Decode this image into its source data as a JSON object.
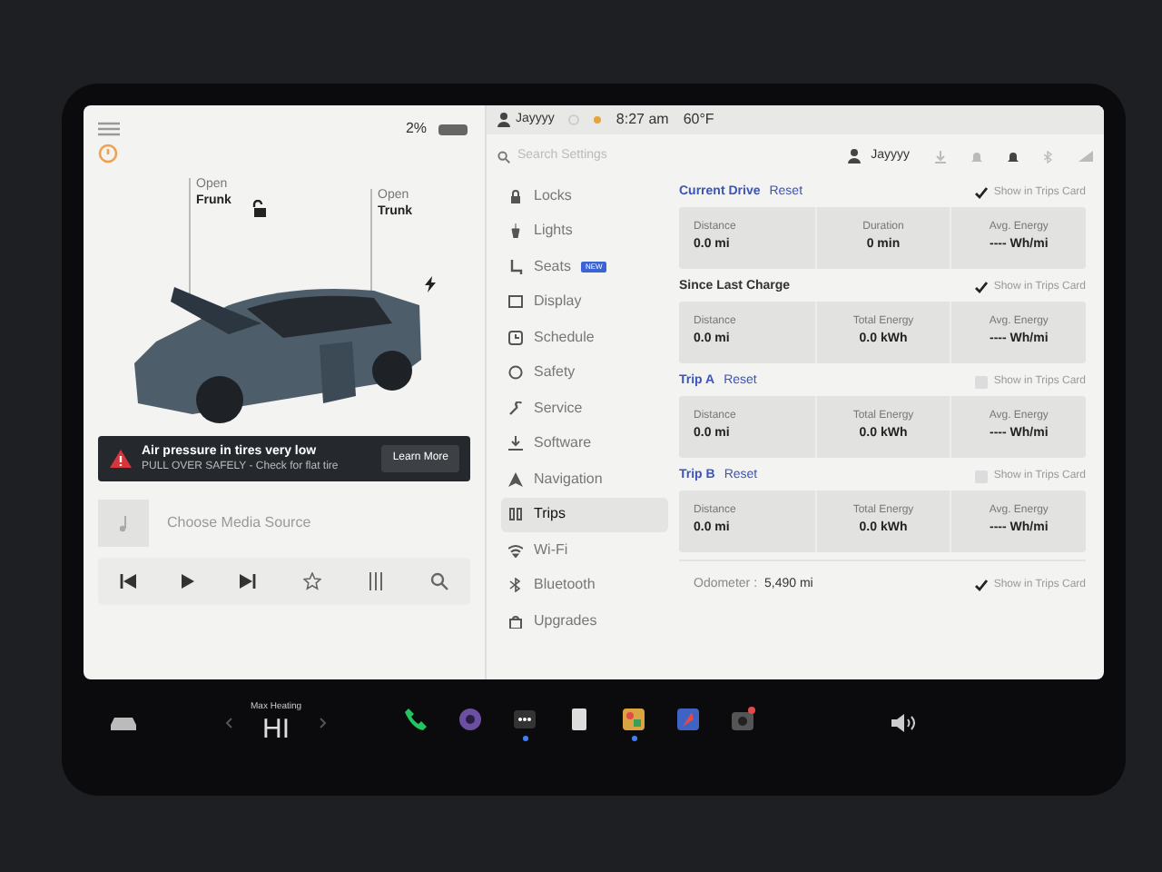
{
  "status_bar": {
    "battery": "2%",
    "user": "Jayyyy",
    "time": "8:27 am",
    "temperature": "60°F"
  },
  "car": {
    "labels": [
      {
        "line1": "Open",
        "line2": "Frunk"
      },
      {
        "line1": "Open",
        "line2": "Trunk"
      }
    ]
  },
  "alert": {
    "title": "Air pressure in tires very low",
    "message": "PULL OVER SAFELY - Check for flat tire",
    "button": "Learn More"
  },
  "media": {
    "source": "Choose Media Source"
  },
  "settings": {
    "search_placeholder": "Search Settings",
    "profile": "Jayyyy",
    "menu": [
      {
        "label": "Locks",
        "kind": "lock",
        "selected": false
      },
      {
        "label": "Lights",
        "kind": "light",
        "selected": false
      },
      {
        "label": "Seats",
        "kind": "seat",
        "badge": "NEW",
        "selected": false
      },
      {
        "label": "Display",
        "kind": "display",
        "selected": false
      },
      {
        "label": "Schedule",
        "kind": "clock",
        "selected": false
      },
      {
        "label": "Safety",
        "kind": "circle",
        "selected": false
      },
      {
        "label": "Service",
        "kind": "wrench",
        "selected": false
      },
      {
        "label": "Software",
        "kind": "download",
        "selected": false
      },
      {
        "label": "Navigation",
        "kind": "nav",
        "selected": false
      },
      {
        "label": "Trips",
        "kind": "trips",
        "selected": true
      },
      {
        "label": "Wi-Fi",
        "kind": "wifi",
        "selected": false
      },
      {
        "label": "Bluetooth",
        "kind": "bt",
        "selected": false
      },
      {
        "label": "Upgrades",
        "kind": "bag",
        "selected": false
      }
    ],
    "sections": [
      {
        "title": "Current Drive",
        "reset": "Reset",
        "show_label": "Show in Trips Card",
        "checked": true,
        "stats": [
          {
            "label": "Distance",
            "value": "0.0 mi"
          },
          {
            "label": "Duration",
            "value": "0 min"
          },
          {
            "label": "Avg. Energy",
            "value": "---- Wh/mi"
          }
        ]
      },
      {
        "title": "Since Last Charge",
        "show_label": "Show in Trips Card",
        "checked": true,
        "stats": [
          {
            "label": "Distance",
            "value": "0.0 mi"
          },
          {
            "label": "Total Energy",
            "value": "0.0 kWh"
          },
          {
            "label": "Avg. Energy",
            "value": "---- Wh/mi"
          }
        ]
      },
      {
        "title": "Trip A",
        "reset": "Reset",
        "show_label": "Show in Trips Card",
        "checked": false,
        "stats": [
          {
            "label": "Distance",
            "value": "0.0 mi"
          },
          {
            "label": "Total Energy",
            "value": "0.0 kWh"
          },
          {
            "label": "Avg. Energy",
            "value": "---- Wh/mi"
          }
        ]
      },
      {
        "title": "Trip B",
        "reset": "Reset",
        "show_label": "Show in Trips Card",
        "checked": false,
        "stats": [
          {
            "label": "Distance",
            "value": "0.0 mi"
          },
          {
            "label": "Total Energy",
            "value": "0.0 kWh"
          },
          {
            "label": "Avg. Energy",
            "value": "---- Wh/mi"
          }
        ]
      }
    ],
    "odometer": {
      "label": "Odometer :",
      "value": "5,490 mi",
      "show_label": "Show in Trips Card",
      "checked": true
    }
  },
  "taskbar": {
    "climate_label": "Max Heating",
    "climate_value": "HI",
    "apps": [
      {
        "kind": "phone",
        "dot": false
      },
      {
        "kind": "camera",
        "dot": false
      },
      {
        "kind": "more",
        "dot": true
      },
      {
        "kind": "notes",
        "dot": false
      },
      {
        "kind": "toybox",
        "dot": true
      },
      {
        "kind": "map",
        "dot": false
      },
      {
        "kind": "dashcam",
        "dot": false
      }
    ]
  }
}
